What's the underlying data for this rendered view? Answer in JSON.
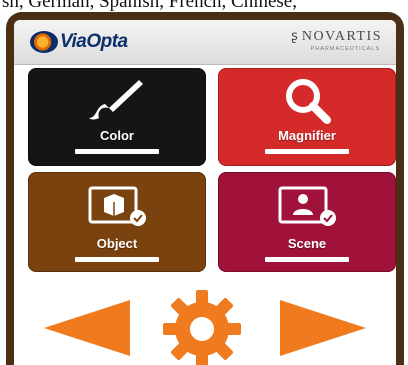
{
  "caption": "sh, German, Spanish, French, Chinese,",
  "header": {
    "app_name": "ViaOpta",
    "partner_name": "NOVARTIS",
    "partner_subtitle": "PHARMACEUTICALS"
  },
  "tiles": [
    {
      "label": "Color",
      "color": "#151515",
      "icon": "paintbrush-icon"
    },
    {
      "label": "Magnifier",
      "color": "#d42a2a",
      "icon": "magnifier-icon"
    },
    {
      "label": "Object",
      "color": "#7a420e",
      "icon": "object-icon"
    },
    {
      "label": "Scene",
      "color": "#a0123a",
      "icon": "scene-icon"
    }
  ],
  "bottom_bar": {
    "accent": "#f07a1e",
    "icons": [
      "arrow-left-icon",
      "gear-icon",
      "arrow-right-icon"
    ]
  },
  "colors": {
    "frame": "#4a2f14",
    "accent": "#f07a1e"
  }
}
